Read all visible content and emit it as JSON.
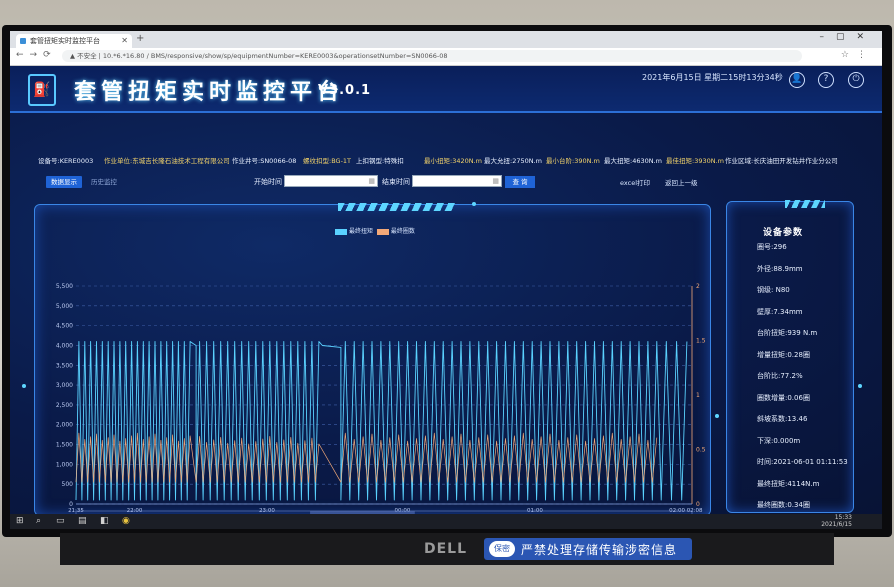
{
  "browser": {
    "tab_title": "套管扭矩实时监控平台",
    "url": "▲ 不安全 | 10.*6.*16.80 / BMS/responsive/show/sp/equipmentNumber=KERE0003&operationsetNumber=SN0066-08"
  },
  "header": {
    "title": "套管扭矩实时监控平台",
    "version": "V3.0.1",
    "datetime": "2021年6月15日 星期二15时13分34秒"
  },
  "info": {
    "device": "设备号:KERE0003",
    "unit": "作业单位:东城吉长隆石油技术工程有限公司",
    "well": "作业井号:SN0066-08",
    "thread": "螺纹扣型:BG-1T",
    "pipe": "上扣钢型:特殊扣",
    "min_torque": "最小扭矩:3420N.m",
    "max_torque_allow": "最大允扭:2750N.m",
    "min_alarm": "最小台阶:390N.m",
    "max_torque": "最大扭矩:4630N.m",
    "best_torque": "最佳扭矩:3930N.m",
    "area": "作业区域:长庆油田开发钻井作业分公司"
  },
  "toolbar": {
    "btn_realtime": "数据显示",
    "btn_history": "历史监控",
    "start_label": "开始时间",
    "end_label": "结束时间",
    "query": "查 询",
    "excel": "excel打印",
    "back": "返回上一级"
  },
  "chart_data": {
    "type": "line",
    "legend": [
      "最终扭矩",
      "最终圈数"
    ],
    "ylim_left": [
      0,
      5500
    ],
    "yticks_left": [
      "5,500",
      "5,000",
      "4,500",
      "4,000",
      "3,500",
      "3,000",
      "2,500",
      "2,000",
      "1,500",
      "1,000",
      "500",
      "0"
    ],
    "ylim_right": [
      0,
      2
    ],
    "yticks_right": [
      "2",
      "1.5",
      "1",
      "0.5",
      "0"
    ],
    "xticks": [
      {
        "t": "21:35",
        "d": "05-31"
      },
      {
        "t": "22:00",
        "d": "05-31"
      },
      {
        "t": "23:00",
        "d": "05-31"
      },
      {
        "t": "00:00",
        "d": "06-01"
      },
      {
        "t": "01:00",
        "d": "06-01"
      },
      {
        "t": "02:00 02:08",
        "d": "06-01 06-01"
      }
    ],
    "series": [
      {
        "name": "最终扭矩",
        "color": "#5ad2ff",
        "segments": [
          {
            "x0": 0.0,
            "x1": 0.19,
            "n": 20,
            "peak": 4100,
            "trough": 100
          },
          {
            "x0": 0.19,
            "x1": 0.195,
            "n": 1,
            "peak": 4050,
            "trough": 4000
          },
          {
            "x0": 0.195,
            "x1": 0.4,
            "n": 18,
            "peak": 4100,
            "trough": 100
          },
          {
            "x0": 0.4,
            "x1": 0.43,
            "n": 1,
            "peak": 4000,
            "trough": 3950
          },
          {
            "x0": 0.43,
            "x1": 0.95,
            "n": 36,
            "peak": 4100,
            "trough": 100
          },
          {
            "x0": 0.95,
            "x1": 1.0,
            "n": 3,
            "peak": 4100,
            "trough": 100
          }
        ]
      },
      {
        "name": "最终圈数",
        "color": "#f2a878",
        "segments": [
          {
            "x0": 0.0,
            "x1": 0.19,
            "n": 20,
            "peak": 0.65,
            "trough": 0.2
          },
          {
            "x0": 0.195,
            "x1": 0.4,
            "n": 18,
            "peak": 0.62,
            "trough": 0.2
          },
          {
            "x0": 0.43,
            "x1": 0.95,
            "n": 36,
            "peak": 0.65,
            "trough": 0.2
          }
        ]
      }
    ]
  },
  "params": {
    "title": "设备参数",
    "items": [
      "圈号:296",
      "外径:88.9mm",
      "钢级: N80",
      "壁厚:7.34mm",
      "台阶扭矩:939 N.m",
      "增量扭矩:0.28圈",
      "台阶比:77.2%",
      "圈数增量:0.06圈",
      "斜坡系数:13.46",
      "下深:0.000m",
      "时间:2021-06-01 01:11:53",
      "最终扭矩:4114N.m",
      "最终圈数:0.34圈"
    ]
  },
  "taskbar": {
    "time": "15:33",
    "date": "2021/6/15"
  },
  "monitor": {
    "brand": "DELL",
    "sticker_badge": "保密",
    "sticker": "严禁处理存储传输涉密信息"
  }
}
